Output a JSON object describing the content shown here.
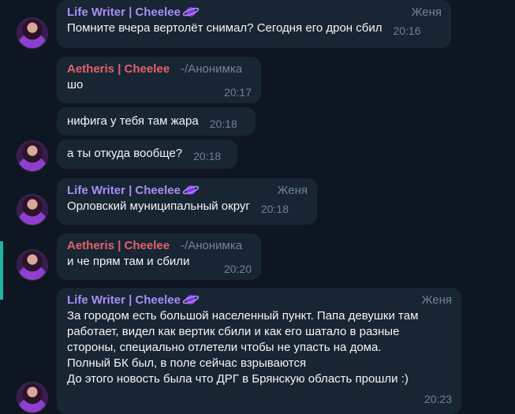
{
  "messages": [
    {
      "author": "Life Writer | Cheelee",
      "role": "Женя",
      "text": "Помните вчера вертолёт снимал? Сегодня его дрон сбил",
      "time": "20:16"
    },
    {
      "author": "Aetheris | Cheelee",
      "role": "-/Анонимка",
      "text": "шо",
      "time": "20:17"
    },
    {
      "text": "нифига у тебя там жара",
      "time": "20:18"
    },
    {
      "text": "а ты откуда вообще?",
      "time": "20:18"
    },
    {
      "author": "Life Writer | Cheelee",
      "role": "Женя",
      "text": "Орловский муниципальный округ",
      "time": "20:18"
    },
    {
      "author": "Aetheris | Cheelee",
      "role": "-/Анонимка",
      "text": "и че прям там и сбили",
      "time": "20:20"
    },
    {
      "author": "Life Writer | Cheelee",
      "role": "Женя",
      "text": "За городом есть большой населенный пункт. Папа девушки там\nработает, видел как вертик сбили и как его шатало в разные\nстороны, специально отлетели чтобы не упасть на дома.\nПолный БК был, в поле сейчас взрываются\nДо этого новость была что ДРГ в Брянскую область прошли :)",
      "time": "20:23"
    }
  ],
  "colors": {
    "background": "#0e1621",
    "bubble": "#182533",
    "lw_name": "#a98ff4",
    "ae_name": "#e4626a",
    "accent": "#1fb5a0"
  },
  "icons": {
    "name_badge": "purple-planet-emoji"
  }
}
